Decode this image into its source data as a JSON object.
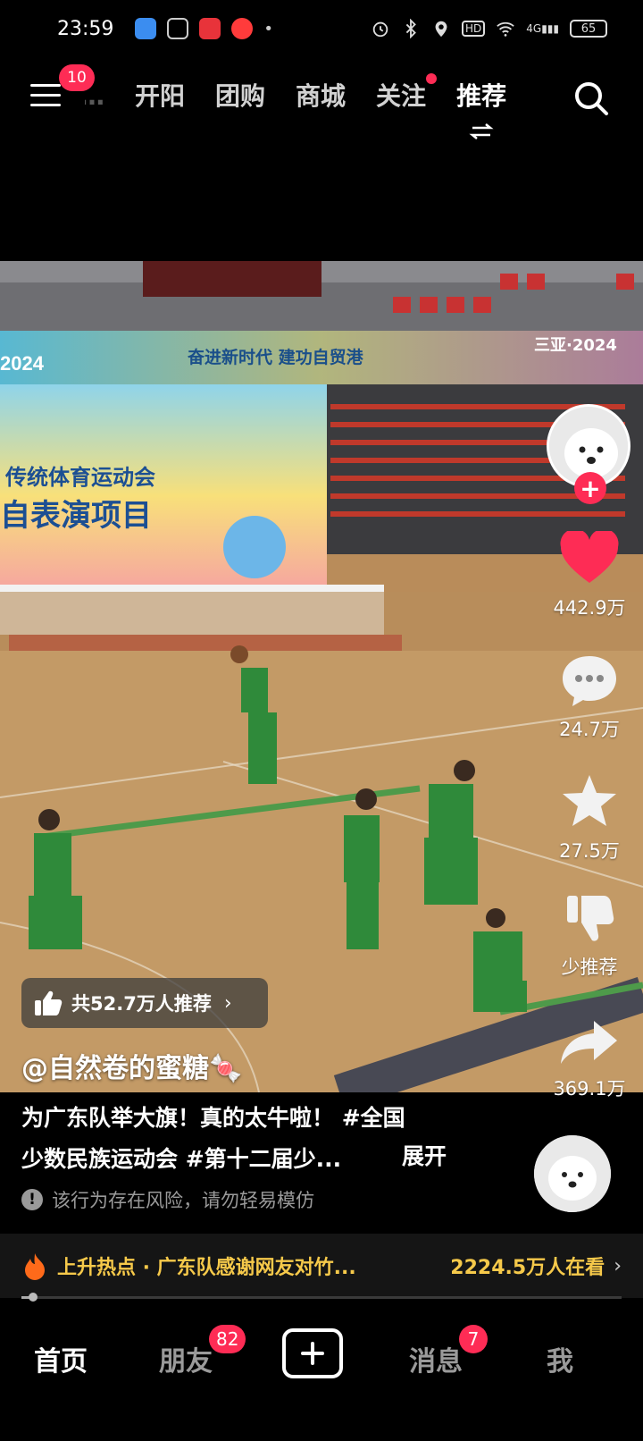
{
  "status_bar": {
    "time": "23:59",
    "battery": "65",
    "network": "4G",
    "hd_label": "HD"
  },
  "top_nav": {
    "menu_badge": "10",
    "tabs": [
      {
        "label": "…选",
        "state": "partial"
      },
      {
        "label": "开阳",
        "state": "normal"
      },
      {
        "label": "团购",
        "state": "normal"
      },
      {
        "label": "商城",
        "state": "normal"
      },
      {
        "label": "关注",
        "state": "dot"
      },
      {
        "label": "推荐",
        "state": "active"
      }
    ]
  },
  "video": {
    "banner_text": "奋进新时代  建功自贸港",
    "banner_year_left": "2024",
    "banner_year_right": "三亚·2024",
    "board_line1": "传统体育运动会",
    "board_line2": "自表演项目"
  },
  "actions": {
    "likes": "442.9万",
    "comments": "24.7万",
    "favorites": "27.5万",
    "dislike_label": "少推荐",
    "shares": "369.1万"
  },
  "post": {
    "recommend": "共52.7万人推荐",
    "author": "@自然卷的蜜糖🍬",
    "caption_line1": "为广东队举大旗！真的太牛啦！ #全国",
    "caption_line2": "少数民族运动会 #第十二届少...",
    "expand_label": "展开",
    "risk_notice": "该行为存在风险，请勿轻易模仿"
  },
  "hot_bar": {
    "text": "上升热点 · 广东队感谢网友对竹...",
    "viewers": "2224.5万人在看",
    "progress": 0.02
  },
  "tab_bar": {
    "home": "首页",
    "friends": "朋友",
    "friends_badge": "82",
    "messages": "消息",
    "messages_badge": "7",
    "me": "我"
  },
  "colors": {
    "accent": "#fe2c55",
    "hot": "#f6c94a",
    "floor": "#b98c5a",
    "uniform": "#2f8a3a"
  }
}
